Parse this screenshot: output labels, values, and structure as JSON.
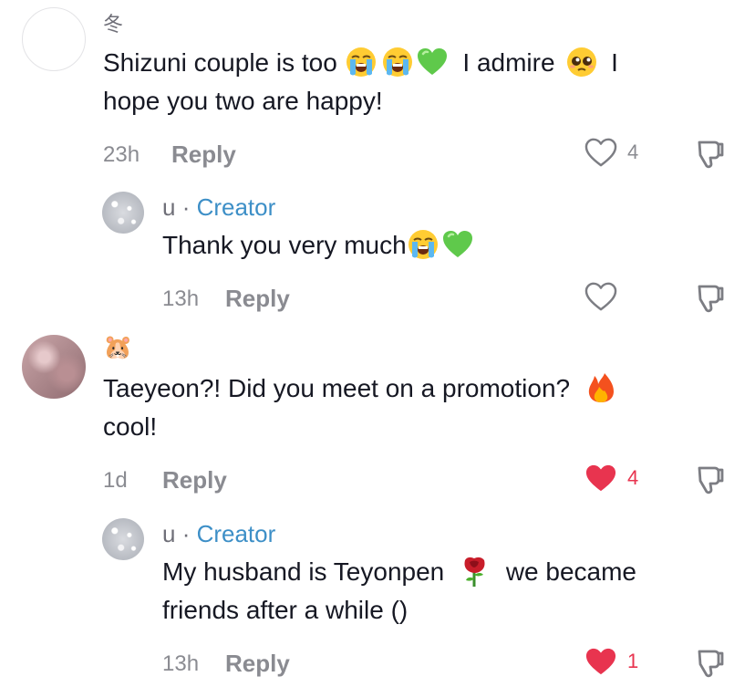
{
  "comments": [
    {
      "username": "冬",
      "text_line1": "Shizuni couple is too",
      "text_mid": "I admire",
      "text_end": "I",
      "text_line2": "hope you two are happy!",
      "time": "23h",
      "reply_label": "Reply",
      "likes": "4",
      "liked": false
    },
    {
      "username": "u",
      "creator_label": "Creator",
      "text": "Thank you very much",
      "time": "13h",
      "reply_label": "Reply",
      "likes": "",
      "liked": false
    },
    {
      "username": "🐹",
      "text_line1": "Taeyeon?! Did you meet on a promotion?",
      "text_line2": "cool!",
      "time": "1d",
      "reply_label": "Reply",
      "likes": "4",
      "liked": true
    },
    {
      "username": "u",
      "creator_label": "Creator",
      "text_line1a": "My husband is Teyonpen",
      "text_line1b": "we became",
      "text_line2": "friends after a while ()",
      "time": "13h",
      "reply_label": "Reply",
      "likes": "1",
      "liked": true
    }
  ],
  "icons": {
    "like": "heart-outline-icon",
    "liked": "heart-filled-icon",
    "dislike": "thumbs-down-icon",
    "loudly_crying": "loudly-crying-face-emoji",
    "green_heart": "green-heart-emoji",
    "pleading": "pleading-face-emoji",
    "fire": "fire-emoji",
    "rose": "rose-emoji"
  },
  "colors": {
    "creator": "#3d8fc7",
    "liked": "#e8344f",
    "meta": "#8a8b91"
  }
}
